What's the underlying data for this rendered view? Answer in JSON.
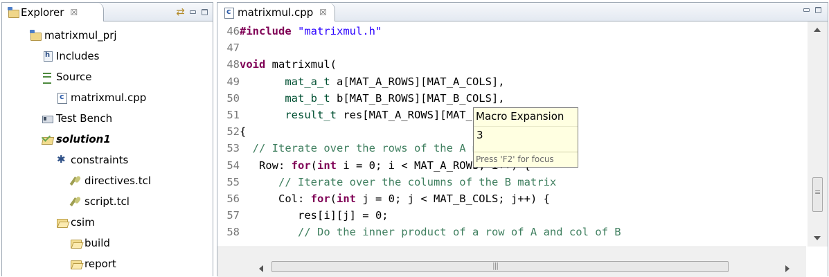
{
  "explorer": {
    "tab_label": "Explorer",
    "close_glyph": "☒",
    "tree": [
      {
        "label": "matrixmul_prj",
        "icon": "project-icon",
        "bold": false
      },
      {
        "label": "Includes",
        "icon": "includes-icon",
        "bold": false
      },
      {
        "label": "Source",
        "icon": "source-icon",
        "bold": false
      },
      {
        "label": "matrixmul.cpp",
        "icon": "cpp-file-icon",
        "bold": false
      },
      {
        "label": "Test Bench",
        "icon": "test-bench-icon",
        "bold": false
      },
      {
        "label": "solution1",
        "icon": "solution-icon",
        "bold": true
      },
      {
        "label": "constraints",
        "icon": "constraints-icon",
        "bold": false
      },
      {
        "label": "directives.tcl",
        "icon": "tcl-file-icon",
        "bold": false
      },
      {
        "label": "script.tcl",
        "icon": "tcl-file-icon",
        "bold": false
      },
      {
        "label": "csim",
        "icon": "folder-icon",
        "bold": false
      },
      {
        "label": "build",
        "icon": "folder-icon",
        "bold": false
      },
      {
        "label": "report",
        "icon": "folder-icon",
        "bold": false
      }
    ]
  },
  "editor": {
    "tab_label": "matrixmul.cpp",
    "close_glyph": "☒",
    "lines": [
      {
        "num": "46",
        "tokens": [
          [
            "kw",
            "#include "
          ],
          [
            "str",
            "\"matrixmul.h\""
          ]
        ]
      },
      {
        "num": "47",
        "tokens": []
      },
      {
        "num": "48",
        "tokens": [
          [
            "kw",
            "void "
          ],
          [
            "cl",
            "matrixmul("
          ]
        ]
      },
      {
        "num": "49",
        "tokens": [
          [
            "cl",
            "       "
          ],
          [
            "ty",
            "mat_a_t"
          ],
          [
            "cl",
            " a[MAT_A_ROWS][MAT_A_COLS],"
          ]
        ]
      },
      {
        "num": "50",
        "tokens": [
          [
            "cl",
            "       "
          ],
          [
            "ty",
            "mat_b_t"
          ],
          [
            "cl",
            " b[MAT_B_ROWS][MAT_B_COLS],"
          ]
        ]
      },
      {
        "num": "51",
        "tokens": [
          [
            "cl",
            "       "
          ],
          [
            "ty",
            "result_t"
          ],
          [
            "cl",
            " res[MAT_A_ROWS][MAT_B_COLS])"
          ]
        ]
      },
      {
        "num": "52",
        "tokens": [
          [
            "cl",
            "{"
          ]
        ]
      },
      {
        "num": "53",
        "tokens": [
          [
            "com",
            "  // Iterate over the rows of the A matrix"
          ]
        ]
      },
      {
        "num": "54",
        "tokens": [
          [
            "cl",
            "   Row: "
          ],
          [
            "kw",
            "for"
          ],
          [
            "cl",
            "("
          ],
          [
            "kw",
            "int"
          ],
          [
            "cl",
            " i = 0; i < MAT_A_ROWS; i++) {"
          ]
        ]
      },
      {
        "num": "55",
        "tokens": [
          [
            "com",
            "      // Iterate over the columns of the B matrix"
          ]
        ]
      },
      {
        "num": "56",
        "tokens": [
          [
            "cl",
            "      Col: "
          ],
          [
            "kw",
            "for"
          ],
          [
            "cl",
            "("
          ],
          [
            "kw",
            "int"
          ],
          [
            "cl",
            " j = 0; j < MAT_B_COLS; j++) {"
          ]
        ]
      },
      {
        "num": "57",
        "tokens": [
          [
            "cl",
            "         res[i][j] = 0;"
          ]
        ]
      },
      {
        "num": "58",
        "tokens": [
          [
            "com",
            "         // Do the inner product of a row of A and col of B"
          ]
        ]
      }
    ]
  },
  "hover": {
    "title": "Macro Expansion",
    "value": "3",
    "footer": "Press 'F2' for focus"
  },
  "colors": {
    "keyword": "#7f0055",
    "string": "#2a00ff",
    "comment": "#3f7f5f",
    "line_number": "#787878",
    "hover_bg": "#ffffe1"
  }
}
